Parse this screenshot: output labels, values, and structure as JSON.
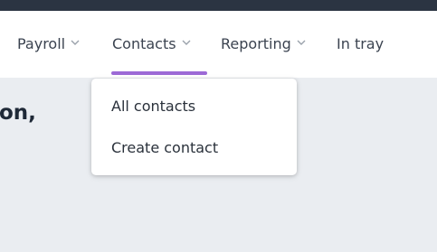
{
  "nav": {
    "items": [
      {
        "label": "Payroll",
        "has_dropdown": true
      },
      {
        "label": "Contacts",
        "has_dropdown": true,
        "active": true
      },
      {
        "label": "Reporting",
        "has_dropdown": true
      },
      {
        "label": "In tray",
        "has_dropdown": false
      }
    ],
    "chevron_icon": "chevron-down-icon"
  },
  "dropdown": {
    "items": [
      {
        "label": "All contacts"
      },
      {
        "label": "Create contact"
      }
    ]
  },
  "main": {
    "greeting_fragment": "on,"
  },
  "colors": {
    "topbar": "#2b3442",
    "active_underline": "#9c6ad6",
    "content_bg": "#eaedf1",
    "nav_text": "#3b4350"
  }
}
